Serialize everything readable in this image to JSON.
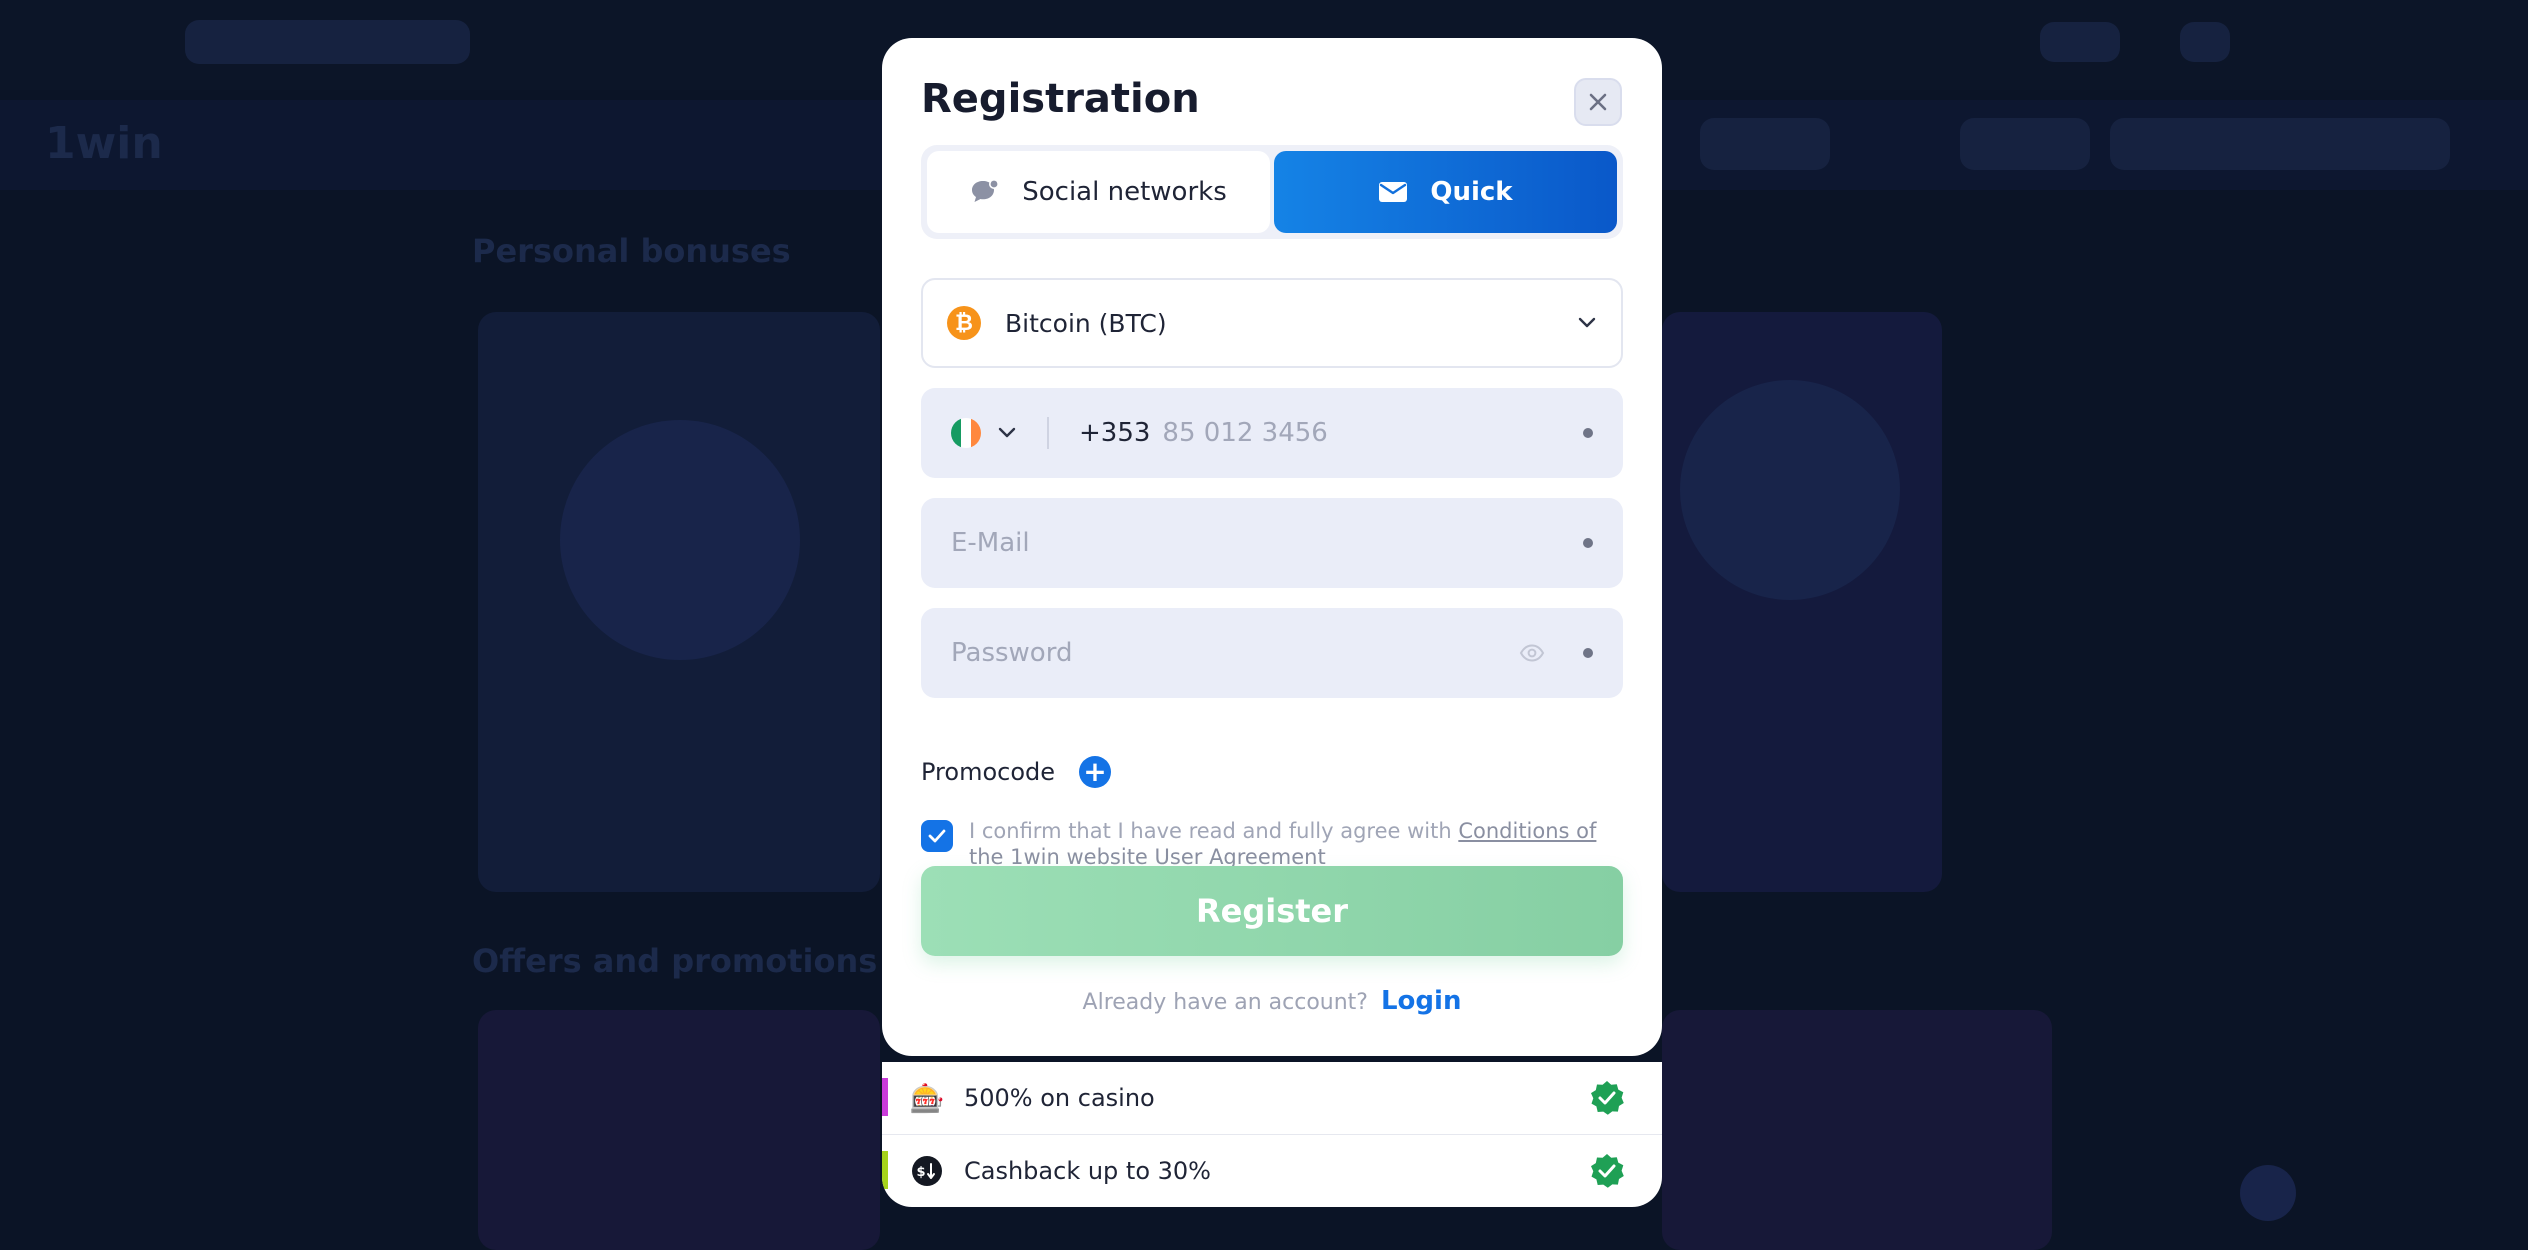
{
  "background": {
    "logo": "1win",
    "nav_items": [
      "",
      "",
      "",
      "",
      ""
    ],
    "section_titles": [
      "Personal bonuses",
      "Offers and promotions"
    ]
  },
  "modal": {
    "title": "Registration",
    "tabs": [
      {
        "label": "Social networks",
        "icon": "chat-bubble-icon",
        "active": false
      },
      {
        "label": "Quick",
        "icon": "envelope-icon",
        "active": true
      }
    ],
    "currency": {
      "label": "Bitcoin (BTC)",
      "symbol": "₿",
      "icon": "bitcoin-icon"
    },
    "phone": {
      "dial_code": "+353",
      "placeholder": "85 012 3456",
      "country_flag": "ireland-flag-icon"
    },
    "email": {
      "placeholder": "E-Mail"
    },
    "password": {
      "placeholder": "Password"
    },
    "promocode": {
      "label": "Promocode",
      "add": "+"
    },
    "agreement": {
      "text": "I confirm that I have read and fully agree with ",
      "link_text": "Conditions of the 1win website User Agreement",
      "checked": true
    },
    "register_label": "Register",
    "login_prompt": "Already have an account?",
    "login_label": "Login"
  },
  "bonuses": [
    {
      "icon": "slot-machine-icon",
      "glyph": "🎰",
      "text": "500% on casino",
      "bar_color": "#c93bd9"
    },
    {
      "icon": "cashback-icon",
      "text": "Cashback up to 30%",
      "bar_color": "#a6d31a"
    }
  ],
  "colors": {
    "accent": "#1473e6",
    "register": "#8fd6ab",
    "success": "#1fa055"
  }
}
